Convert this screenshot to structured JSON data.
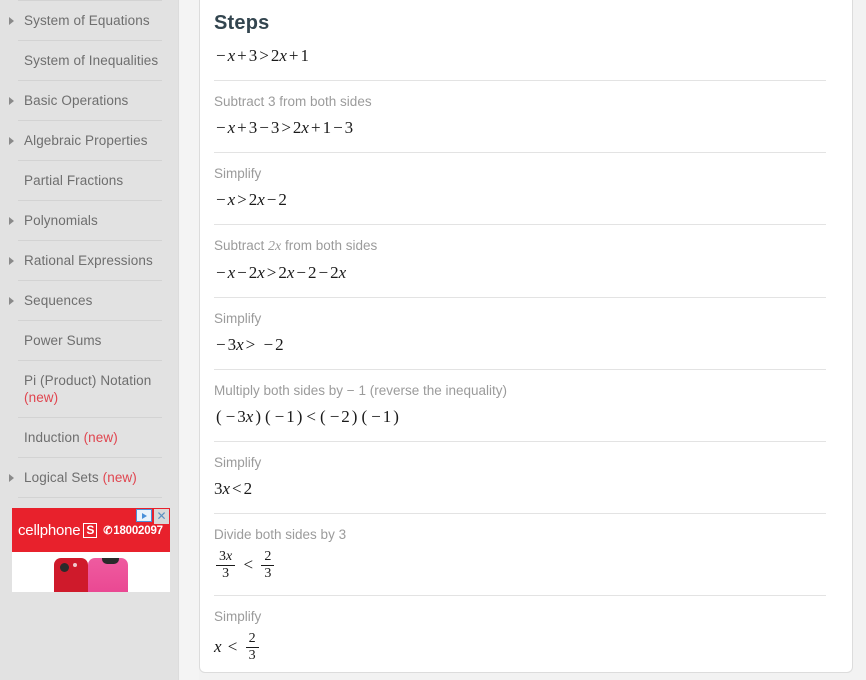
{
  "sidebar": {
    "items": [
      {
        "label": "System of Equations",
        "expandable": true,
        "new": false
      },
      {
        "label": "System of Inequalities",
        "expandable": false,
        "new": false
      },
      {
        "label": "Basic Operations",
        "expandable": true,
        "new": false
      },
      {
        "label": "Algebraic Properties",
        "expandable": true,
        "new": false
      },
      {
        "label": "Partial Fractions",
        "expandable": false,
        "new": false
      },
      {
        "label": "Polynomials",
        "expandable": true,
        "new": false
      },
      {
        "label": "Rational Expressions",
        "expandable": true,
        "new": false
      },
      {
        "label": "Sequences",
        "expandable": true,
        "new": false
      },
      {
        "label": "Power Sums",
        "expandable": false,
        "new": false
      },
      {
        "label": "Pi (Product) Notation",
        "expandable": false,
        "new": true
      },
      {
        "label": "Induction",
        "expandable": false,
        "new": true
      },
      {
        "label": "Logical Sets",
        "expandable": true,
        "new": true
      }
    ],
    "new_badge_text": "(new)",
    "new_badge_color": "#e0454f"
  },
  "ad": {
    "brand": "cellphone",
    "brand_mark": "S",
    "phone_number": "18002097",
    "phone_glyph": "✆",
    "close_label": "✕",
    "adchoices_label": "AdChoices",
    "background_color": "#e8212c"
  },
  "content": {
    "title": "Steps",
    "title_color": "#33454f",
    "problem": "−x + 3 > 2x + 1",
    "steps": [
      {
        "label": "Subtract 3 from both sides",
        "math": "−x + 3 − 3 > 2x + 1 − 3"
      },
      {
        "label": "Simplify",
        "math": "−x > 2x − 2"
      },
      {
        "label": "Subtract 2x from both sides",
        "label_math": "2x",
        "math": "−x − 2x > 2x − 2 − 2x"
      },
      {
        "label": "Simplify",
        "math": "−3x > −2"
      },
      {
        "label": "Multiply both sides by − 1 (reverse the inequality)",
        "math": "(−3x)(−1) < (−2)(−1)"
      },
      {
        "label": "Simplify",
        "math": "3x < 2"
      },
      {
        "label": "Divide both sides by 3",
        "math_fraction": {
          "left_num": "3x",
          "left_den": "3",
          "operator": "<",
          "right_num": "2",
          "right_den": "3"
        }
      },
      {
        "label": "Simplify",
        "math_fraction": {
          "left_plain": "x",
          "operator": "<",
          "right_num": "2",
          "right_den": "3"
        }
      }
    ]
  }
}
